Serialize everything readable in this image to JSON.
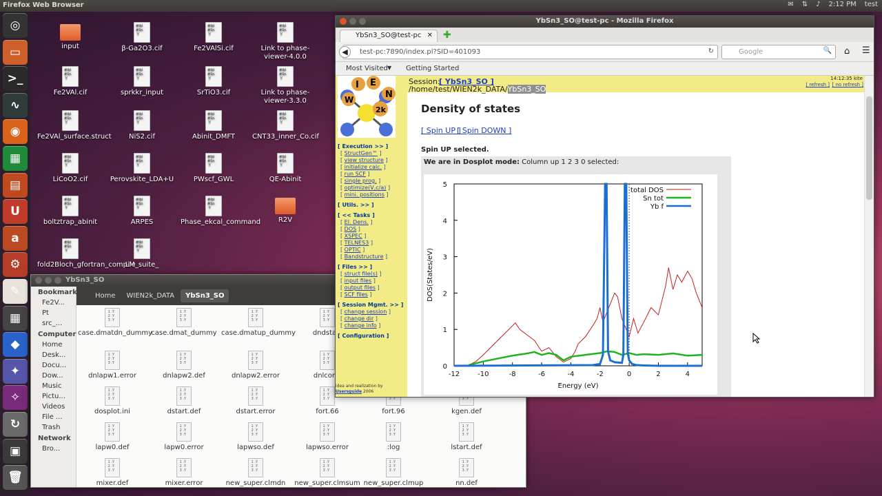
{
  "topbar": {
    "app": "Firefox Web Browser",
    "time": "2:12 PM",
    "user": "test",
    "indicators": [
      "mail-icon",
      "network-icon",
      "volume-icon"
    ]
  },
  "launcher": [
    "Dash Home",
    "Files",
    "Terminal",
    "System Monitor",
    "Firefox",
    "LibreOffice Calc",
    "LibreOffice Impress",
    "Ubuntu Software Center",
    "Amazon",
    "System Settings",
    "Text Editor",
    "Calculator",
    "VESTA",
    "Mirage",
    "ImageMagick",
    "Update Manager 288",
    "Workspace Switcher",
    "Trash"
  ],
  "desktop": [
    {
      "name": "input",
      "type": "folder"
    },
    {
      "name": "β-Ga2O3.cif",
      "type": "file"
    },
    {
      "name": "Fe2VAlSi.cif",
      "type": "file"
    },
    {
      "name": "Link to phase-viewer-4.0.0",
      "type": "file"
    },
    {
      "name": "Fe2VAl.cif",
      "type": "file"
    },
    {
      "name": "sprkkr_input",
      "type": "file"
    },
    {
      "name": "SrTiO3.cif",
      "type": "file"
    },
    {
      "name": "Link to phase-viewer-3.3.0",
      "type": "file"
    },
    {
      "name": "Fe2VAl_surface.struct",
      "type": "file"
    },
    {
      "name": "NiS2.cif",
      "type": "file"
    },
    {
      "name": "Abinit_DMFT",
      "type": "file"
    },
    {
      "name": "CNT33_inner_Co.cif",
      "type": "file"
    },
    {
      "name": "LiCoO2.cif",
      "type": "file"
    },
    {
      "name": "Perovskite_LDA+U",
      "type": "file"
    },
    {
      "name": "PWscf_GWL",
      "type": "file"
    },
    {
      "name": "QE-Abinit",
      "type": "file"
    },
    {
      "name": "boltztrap_abinit",
      "type": "file"
    },
    {
      "name": "ARPES",
      "type": "file"
    },
    {
      "name": "Phase_ekcal_command",
      "type": "file"
    },
    {
      "name": "R2V",
      "type": "folder"
    },
    {
      "name": "fold2Bloch_gfortran_compile",
      "type": "file"
    },
    {
      "name": "LM_suite_",
      "type": "file"
    }
  ],
  "filemanager": {
    "title": "YbSn3_SO",
    "bookmarks_header": "Bookmarks",
    "bookmarks": [
      "Fe2V...",
      "Pt",
      "src_..."
    ],
    "computer_header": "Computer",
    "computer": [
      "Home",
      "Desk...",
      "Docu...",
      "Dow...",
      "Music",
      "Pictu...",
      "Videos",
      "File ...",
      "Trash"
    ],
    "network_header": "Network",
    "network": [
      "Bro..."
    ],
    "breadcrumbs": [
      "Home",
      "WIEN2k_DATA",
      "YbSn3_SO"
    ],
    "files": [
      "case.dmatdn_dummy",
      "case.dmat_dummy",
      "case.dmatup_dummy",
      "dndstart",
      "dnlapw1.error",
      "dnlapw2.def",
      "dnlapw2.error",
      "dnlcore.",
      "dosplot.ini",
      "dstart.def",
      "dstart.error",
      "fort.66",
      "fort.96",
      "kgen.def",
      "lapw0.def",
      "lapw0.error",
      "lapwso.def",
      "lapwso.error",
      ":log",
      "lstart.def",
      "mixer.def",
      "mixer.error",
      "new_super.clmdn",
      "new_super.clmsum",
      "new_super.clmup",
      "nn.def"
    ]
  },
  "firefox": {
    "title": "YbSn3_SO@test-pc - Mozilla Firefox",
    "tab": "YbSn3_SO@test-pc",
    "url": "test-pc:7890/index.pl?SID=401093",
    "search_placeholder": "Google",
    "bookmarks": [
      "Most Visited",
      "Getting Started"
    ]
  },
  "wien": {
    "session_label": "Session:",
    "session_name": "[ YbSn3_SO ]",
    "path": "/home/test/WIEN2k_DATA/",
    "path_sel": "YbSn3_SO",
    "clock": "14:12:35 kite",
    "refresh": "[ refresh ]",
    "norefresh": "[ no refresh ]",
    "menu": [
      {
        "head": "[ Execution >> ]",
        "items": [
          "StructGen™",
          "view structure",
          "initialize calc.",
          "run SCF",
          "single prog.",
          "optimize(V,c/a)",
          "mini. positions"
        ]
      },
      {
        "head": "[ Utils. >> ]",
        "items": []
      },
      {
        "head": "[ << Tasks ]",
        "items": [
          "El. Dens.",
          "DOS",
          "XSPEC",
          "TELNES3",
          "OPTIC",
          "Bandstructure"
        ]
      },
      {
        "head": "[ Files >> ]",
        "items": [
          "struct file(s)",
          "input files",
          "output files",
          "SCF files"
        ]
      },
      {
        "head": "[ Session Mgmt. >> ]",
        "items": [
          "change session",
          "change dir",
          "change info"
        ]
      },
      {
        "head": "[ Configuration ]",
        "items": []
      }
    ],
    "footer": "idea and realization by",
    "usersguide": "Usersguide",
    "year": "2006",
    "heading": "Density of states",
    "spin_up": "[ Spin UP ]",
    "spin_down": "[ Spin DOWN ]",
    "spin_sel": "Spin UP selected.",
    "mode_bold": "We are in Dosplot mode:",
    "mode_text": "Column up 1 2 3 0 selected:"
  },
  "chart_data": {
    "type": "line",
    "xlabel": "Energy (eV)",
    "ylabel": "DOS(States/eV)",
    "xlim": [
      -12,
      5
    ],
    "ylim": [
      0,
      5
    ],
    "xticks": [
      -12,
      -10,
      -8,
      -6,
      -4,
      -2,
      0,
      2,
      4
    ],
    "yticks": [
      0,
      1,
      2,
      3,
      4,
      5
    ],
    "fermi_level": 0,
    "series": [
      {
        "name": "total DOS",
        "color": "#c41e1e",
        "x": [
          -11,
          -10.5,
          -10,
          -9.5,
          -9,
          -8.5,
          -8,
          -7.8,
          -7.5,
          -7,
          -6.5,
          -6,
          -5.5,
          -5,
          -4.5,
          -4,
          -3.7,
          -3.5,
          -3,
          -2.5,
          -2.2,
          -2,
          -1.8,
          -1.5,
          -1.2,
          -1,
          -0.8,
          -0.5,
          -0.2,
          0,
          0.3,
          0.6,
          1,
          1.5,
          2,
          2.5,
          2.7,
          3,
          3.3,
          3.6,
          4,
          4.3,
          4.6,
          5
        ],
        "y": [
          0.02,
          0.12,
          0.3,
          0.5,
          0.7,
          0.9,
          1.1,
          1.18,
          1.0,
          0.85,
          0.7,
          0.4,
          0.5,
          0.25,
          0.1,
          0.2,
          0.4,
          0.6,
          0.8,
          1.1,
          1.3,
          1.6,
          1.2,
          1.5,
          1.8,
          2.0,
          1.9,
          1.3,
          1.0,
          0.8,
          1.3,
          0.9,
          1.2,
          1.6,
          1.4,
          2.2,
          2.7,
          2.1,
          2.5,
          2.3,
          2.6,
          2.4,
          2.0,
          1.6
        ]
      },
      {
        "name": "Sn tot",
        "color": "#1db31d",
        "x": [
          -11,
          -10,
          -9,
          -8,
          -7,
          -6.5,
          -6,
          -5.5,
          -5,
          -4.5,
          -4,
          -3,
          -2,
          -1.5,
          -1,
          -0.5,
          0,
          0.5,
          1,
          2,
          3,
          4,
          5
        ],
        "y": [
          0.02,
          0.12,
          0.2,
          0.28,
          0.34,
          0.38,
          0.3,
          0.35,
          0.3,
          0.15,
          0.25,
          0.3,
          0.35,
          0.4,
          0.38,
          0.3,
          0.35,
          0.3,
          0.32,
          0.3,
          0.34,
          0.28,
          0.3
        ]
      },
      {
        "name": "Yb f",
        "color": "#1a6fd1",
        "x": [
          -12,
          -2.5,
          -2,
          -1.8,
          -1.65,
          -1.55,
          -1.45,
          -1.3,
          -1,
          -0.5,
          -0.4,
          -0.3,
          -0.2,
          -0.1,
          0,
          0.2,
          0.5,
          1,
          2,
          5
        ],
        "y": [
          0,
          0.02,
          0.05,
          0.3,
          5,
          5,
          0.4,
          0.15,
          0.1,
          0.08,
          0.3,
          5,
          5,
          0.35,
          0.15,
          0.05,
          0.02,
          0.01,
          0,
          0
        ]
      }
    ]
  }
}
